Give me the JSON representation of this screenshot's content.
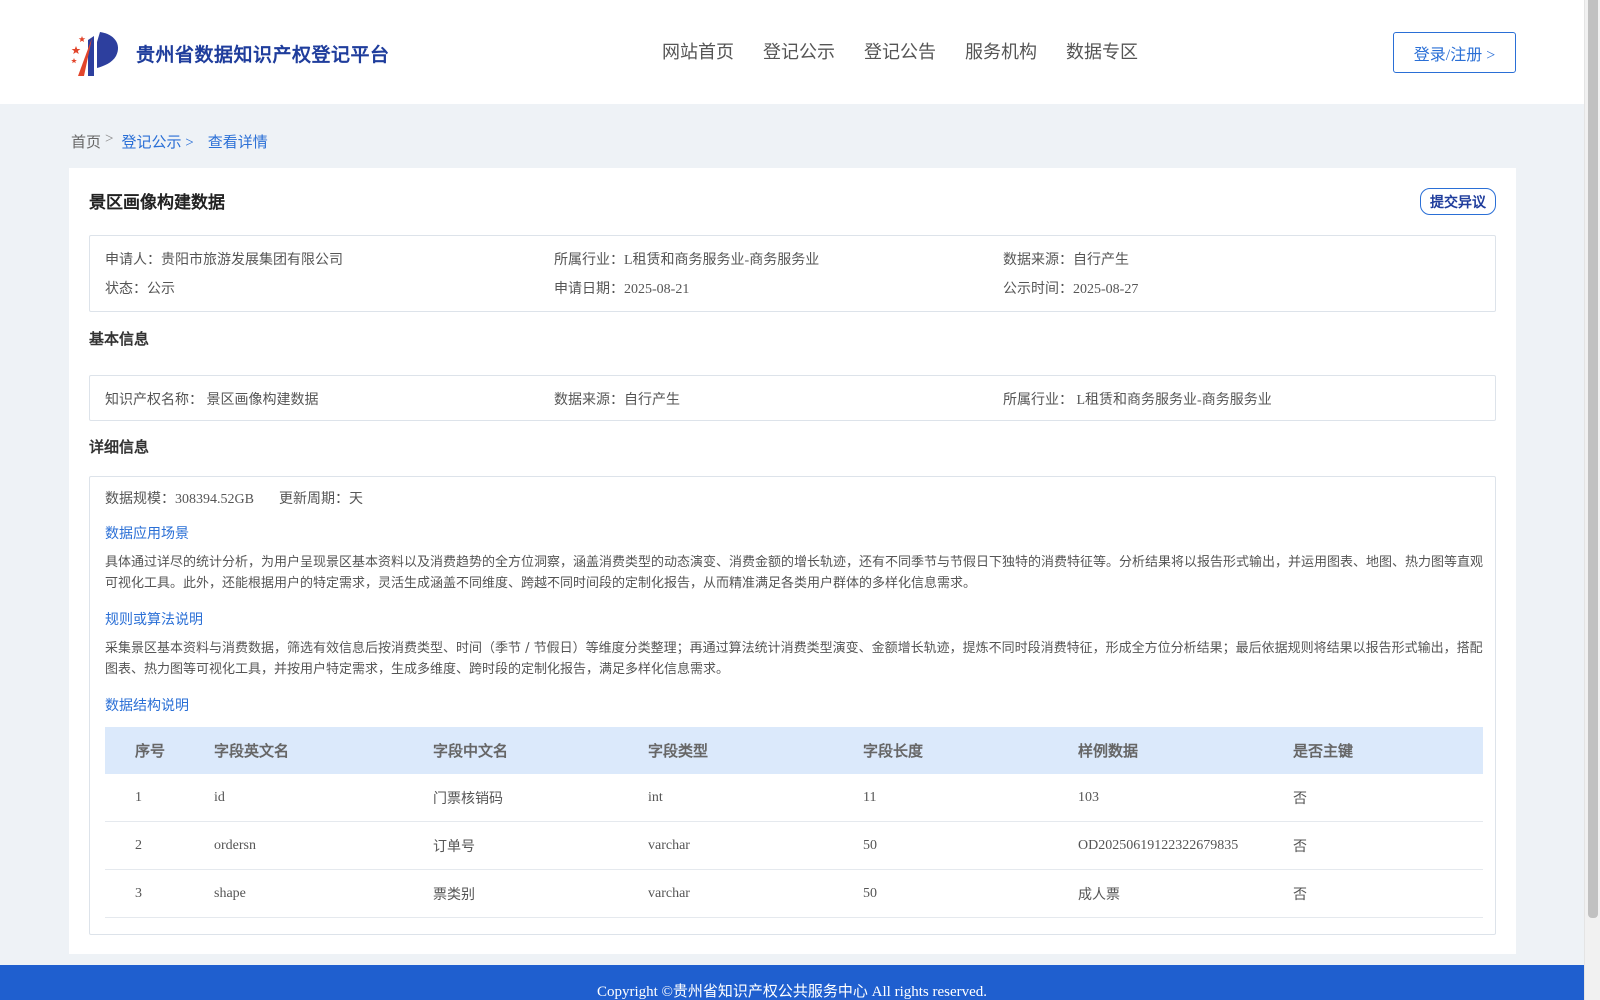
{
  "header": {
    "logo_text": "贵州省数据知识产权登记平台",
    "nav": [
      "网站首页",
      "登记公示",
      "登记公告",
      "服务机构",
      "数据专区"
    ],
    "login_label": "登录/注册 >"
  },
  "breadcrumb": {
    "home": "首页",
    "sep": ">",
    "list": "登记公示 >",
    "current": "查看详情"
  },
  "record": {
    "title": "景区画像构建数据",
    "objection_label": "提交异议",
    "applicant_label": "申请人：",
    "applicant": "贵阳市旅游发展集团有限公司",
    "industry_label": "所属行业：",
    "industry": "L租赁和商务服务业-商务服务业",
    "source_label": "数据来源：",
    "source": "自行产生",
    "status_label": "状态：",
    "status": "公示",
    "apply_date_label": "申请日期：",
    "apply_date": "2025-08-21",
    "publish_time_label": "公示时间：",
    "publish_time": "2025-08-27"
  },
  "basic": {
    "section_title": "基本信息",
    "ip_name_label": "知识产权名称：",
    "ip_name": "景区画像构建数据",
    "source_label": "数据来源：",
    "source": "自行产生",
    "industry_label": "所属行业：",
    "industry": "L租赁和商务服务业-商务服务业"
  },
  "detail": {
    "section_title": "详细信息",
    "scale_label": "数据规模：",
    "scale": "308394.52GB",
    "cycle_label": "更新周期：",
    "cycle": "天",
    "scenario_title": "数据应用场景",
    "scenario_text": "具体通过详尽的统计分析，为用户呈现景区基本资料以及消费趋势的全方位洞察，涵盖消费类型的动态演变、消费金额的增长轨迹，还有不同季节与节假日下独特的消费特征等。分析结果将以报告形式输出，并运用图表、地图、热力图等直观可视化工具。此外，还能根据用户的特定需求，灵活生成涵盖不同维度、跨越不同时间段的定制化报告，从而精准满足各类用户群体的多样化信息需求。",
    "algorithm_title": "规则或算法说明",
    "algorithm_text": "采集景区基本资料与消费数据，筛选有效信息后按消费类型、时间（季节 / 节假日）等维度分类整理；再通过算法统计消费类型演变、金额增长轨迹，提炼不同时段消费特征，形成全方位分析结果；最后依据规则将结果以报告形式输出，搭配图表、热力图等可视化工具，并按用户特定需求，生成多维度、跨时段的定制化报告，满足多样化信息需求。",
    "structure_title": "数据结构说明",
    "columns": [
      "序号",
      "字段英文名",
      "字段中文名",
      "字段类型",
      "字段长度",
      "样例数据",
      "是否主键"
    ],
    "rows": [
      [
        "1",
        "id",
        "门票核销码",
        "int",
        "11",
        "103",
        "否"
      ],
      [
        "2",
        "ordersn",
        "订单号",
        "varchar",
        "50",
        "OD20250619122322679835",
        "否"
      ],
      [
        "3",
        "shape",
        "票类别",
        "varchar",
        "50",
        "成人票",
        "否"
      ]
    ]
  },
  "footer": {
    "copyright": "Copyright ©贵州省知识产权公共服务中心 All rights reserved."
  },
  "colors": {
    "brand_blue": "#2a6fd6",
    "footer_blue": "#1f5fcf",
    "table_header_bg": "#dbe9fb"
  }
}
